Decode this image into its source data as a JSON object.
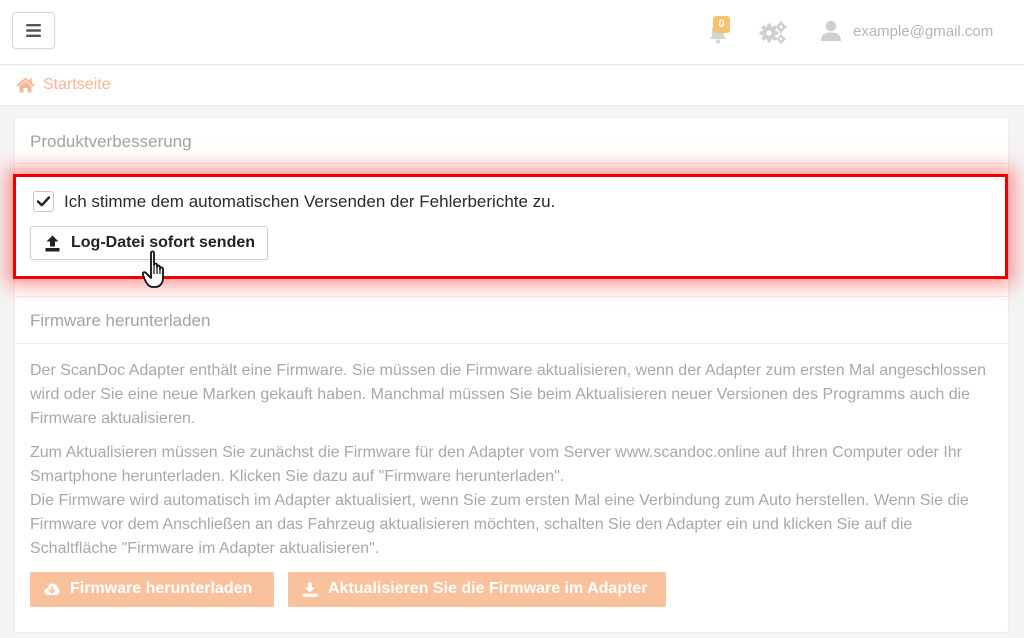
{
  "header": {
    "notification_count": "0",
    "user_email": "example@gmail.com",
    "icons": [
      "menu-icon",
      "bell-icon",
      "gears-icon",
      "user-icon"
    ]
  },
  "breadcrumb": {
    "home_label": "Startseite",
    "icon": "home-icon"
  },
  "product_improvement": {
    "title": "Produktverbesserung",
    "consent_checked": true,
    "consent_label": "Ich stimme dem automatischen Versenden der Fehlerberichte zu.",
    "send_log_button": "Log-Datei sofort senden"
  },
  "firmware": {
    "title": "Firmware herunterladen",
    "paragraph1": "Der ScanDoc Adapter enthält eine Firmware. Sie müssen die Firmware aktualisieren, wenn der Adapter zum ersten Mal angeschlossen wird oder Sie eine neue Marken gekauft haben. Manchmal müssen Sie beim Aktualisieren neuer Versionen des Programms auch die Firmware aktualisieren.",
    "paragraph2_line1": "Zum Aktualisieren müssen Sie zunächst die Firmware für den Adapter vom Server www.scandoc.online auf Ihren Computer oder Ihr Smartphone herunterladen. Klicken Sie dazu auf \"Firmware herunterladen\".",
    "paragraph2_line2": "Die Firmware wird automatisch im Adapter aktualisiert, wenn Sie zum ersten Mal eine Verbindung zum Auto herstellen. Wenn Sie die Firmware vor dem Anschließen an das Fahrzeug aktualisieren möchten, schalten Sie den Adapter ein und klicken Sie auf die Schaltfläche \"Firmware im Adapter aktualisieren\".",
    "download_button": "Firmware herunterladen",
    "update_button": "Aktualisieren Sie die Firmware im Adapter"
  },
  "colors": {
    "accent": "#f9c19c",
    "breadcrumb": "#f7b896",
    "highlight_border": "#ee0000"
  }
}
